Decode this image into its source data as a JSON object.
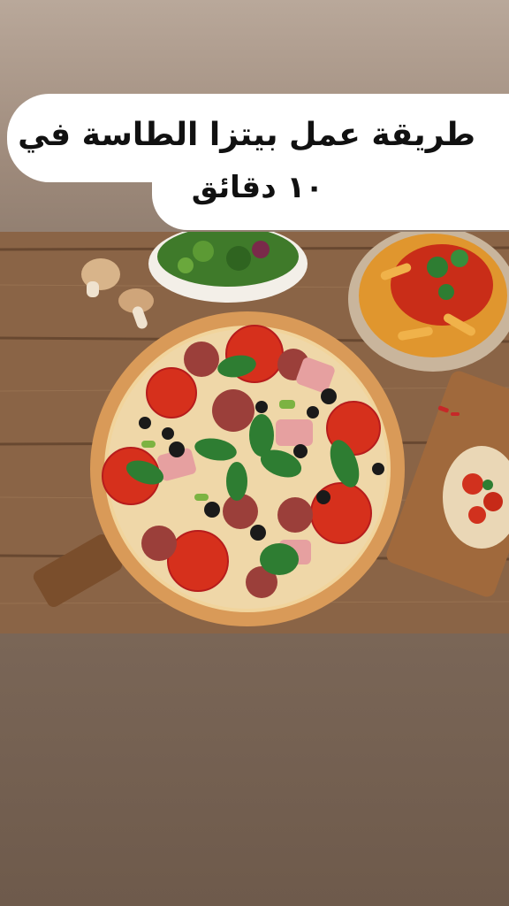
{
  "story": {
    "caption_line1": "طريقة عمل بيتزا الطاسة في",
    "caption_line2": "١٠ دقائق"
  },
  "photo": {
    "subject": "pizza-food-photo"
  },
  "colors": {
    "caption_bg": "#ffffff",
    "caption_text": "#111111",
    "background_top": "#b9a89a",
    "background_bottom": "#6e5a4b"
  }
}
